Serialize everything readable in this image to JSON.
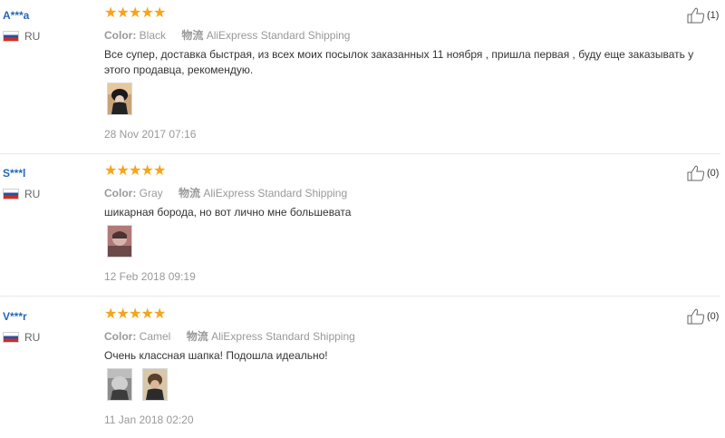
{
  "reviews": [
    {
      "user": "A***a",
      "country": "RU",
      "stars": 5,
      "color_label": "Color:",
      "color_value": "Black",
      "logistics_label": "物流",
      "shipping": "AliExpress Standard Shipping",
      "text": "Все супер, доставка быстрая, из всех моих посылок заказанных 11 ноября , пришла первая , буду еще заказывать у этого продавца, рекомендую.",
      "date": "28 Nov 2017 07:16",
      "likes": "(1)",
      "photos": [
        "photo-girl-black-hat"
      ]
    },
    {
      "user": "S***l",
      "country": "RU",
      "stars": 5,
      "color_label": "Color:",
      "color_value": "Gray",
      "logistics_label": "物流",
      "shipping": "AliExpress Standard Shipping",
      "text": "шикарная борода, но вот лично мне большевата",
      "date": "12 Feb 2018 09:19",
      "likes": "(0)",
      "photos": [
        "photo-gray-hat"
      ]
    },
    {
      "user": "V***r",
      "country": "RU",
      "stars": 5,
      "color_label": "Color:",
      "color_value": "Camel",
      "logistics_label": "物流",
      "shipping": "AliExpress Standard Shipping",
      "text": "Очень классная шапка! Подошла идеально!",
      "date": "11 Jan 2018 02:20",
      "likes": "(0)",
      "photos": [
        "photo-camel-hat-1",
        "photo-camel-hat-2"
      ]
    }
  ]
}
